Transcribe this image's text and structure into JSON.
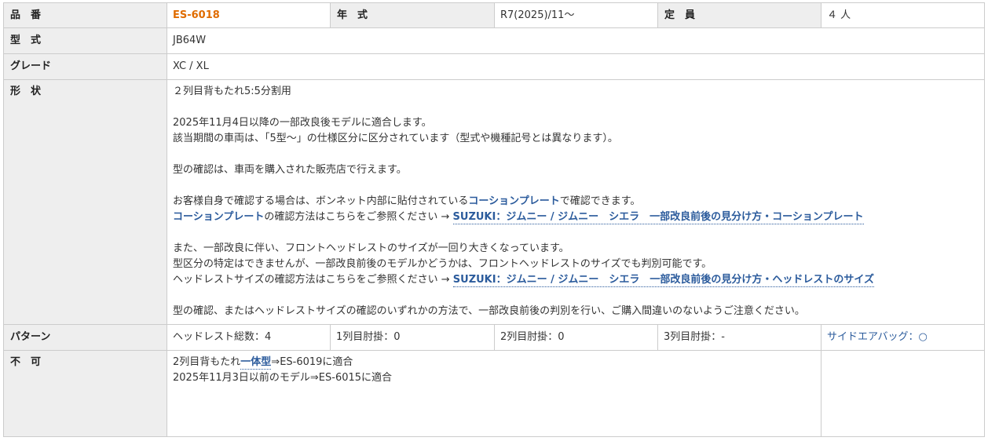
{
  "labels": {
    "part_number": "品　番",
    "year": "年　式",
    "capacity": "定　員",
    "model_code": "型　式",
    "grade": "グレード",
    "shape": "形　状",
    "pattern": "パターン",
    "incompatible": "不　可"
  },
  "values": {
    "part_number": "ES-6018",
    "year": "R7(2025)/11～",
    "capacity": "４ 人",
    "model_code": "JB64W",
    "grade": "XC / XL"
  },
  "shape": {
    "line1": "２列目背もたれ5:5分割用",
    "line2": "2025年11月4日以降の一部改良後モデルに適合します。",
    "line3": "該当期間の車両は、「5型～」の仕様区分に区分されています（型式や機種記号とは異なります）。",
    "line4": "型の確認は、車両を購入された販売店で行えます。",
    "line5_pre": "お客様自身で確認する場合は、ボンネット内部に貼付されている",
    "line5_hl": "コーションプレート",
    "line5_post": "で確認できます。",
    "line6_hl": "コーションプレート",
    "line6_post": "の確認方法はこちらをご参照ください → ",
    "line6_link": "SUZUKI：ジムニー / ジムニー　シエラ　一部改良前後の見分け方・コーションプレート",
    "line7": "また、一部改良に伴い、フロントヘッドレストのサイズが一回り大きくなっています。",
    "line8": "型区分の特定はできませんが、一部改良前後のモデルかどうかは、フロントヘッドレストのサイズでも判別可能です。",
    "line9_pre": "ヘッドレストサイズの確認方法はこちらをご参照ください → ",
    "line9_link": "SUZUKI：ジムニー / ジムニー　シエラ　一部改良前後の見分け方・ヘッドレストのサイズ",
    "line10": "型の確認、またはヘッドレストサイズの確認のいずれかの方法で、一部改良前後の判別を行い、ご購入間違いのないようご注意ください。"
  },
  "pattern": {
    "headrest_total": "ヘッドレスト総数：4",
    "row1_armrest": "1列目肘掛：0",
    "row2_armrest": "2列目肘掛：0",
    "row3_armrest": "3列目肘掛：-",
    "side_airbag": "サイドエアバッグ：○"
  },
  "incompatible": {
    "line1_pre": "2列目背もたれ",
    "line1_hl": "一体型",
    "line1_post": "⇒ES-6019に適合",
    "line2": "2025年11月3日以前のモデル⇒ES-6015に適合"
  },
  "colors": {
    "accent_orange": "#e06c00",
    "link_blue": "#2b5b9c",
    "header_bg": "#eeeeee",
    "border": "#cccccc"
  }
}
